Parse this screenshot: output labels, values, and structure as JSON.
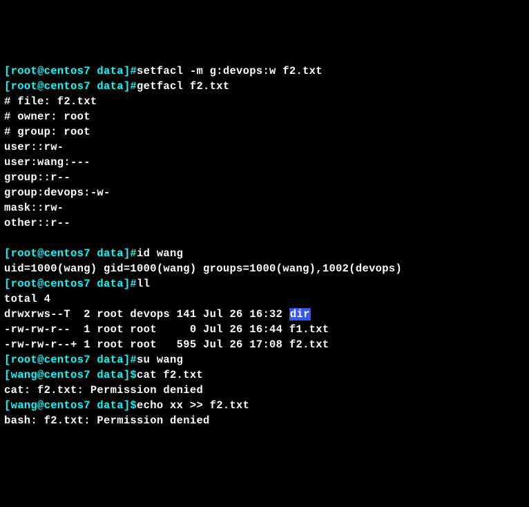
{
  "lines": [
    {
      "segments": [
        {
          "text": "[root@centos7 data]#",
          "class": "cyan"
        },
        {
          "text": "setfacl -m g:devops:w f2.txt",
          "class": "white"
        }
      ]
    },
    {
      "segments": [
        {
          "text": "[root@centos7 data]#",
          "class": "cyan"
        },
        {
          "text": "getfacl f2.txt",
          "class": "white"
        }
      ]
    },
    {
      "segments": [
        {
          "text": "# file: f2.txt",
          "class": "white"
        }
      ]
    },
    {
      "segments": [
        {
          "text": "# owner: root",
          "class": "white"
        }
      ]
    },
    {
      "segments": [
        {
          "text": "# group: root",
          "class": "white"
        }
      ]
    },
    {
      "segments": [
        {
          "text": "user::rw-",
          "class": "white"
        }
      ]
    },
    {
      "segments": [
        {
          "text": "user:wang:---",
          "class": "white"
        }
      ]
    },
    {
      "segments": [
        {
          "text": "group::r--",
          "class": "white"
        }
      ]
    },
    {
      "segments": [
        {
          "text": "group:devops:-w-",
          "class": "white"
        }
      ]
    },
    {
      "segments": [
        {
          "text": "mask::rw-",
          "class": "white"
        }
      ]
    },
    {
      "segments": [
        {
          "text": "other::r--",
          "class": "white"
        }
      ]
    },
    {
      "segments": [
        {
          "text": " ",
          "class": "white"
        }
      ]
    },
    {
      "segments": [
        {
          "text": "[root@centos7 data]#",
          "class": "cyan"
        },
        {
          "text": "id wang",
          "class": "white"
        }
      ]
    },
    {
      "segments": [
        {
          "text": "uid=1000(wang) gid=1000(wang) groups=1000(wang),1002(devops)",
          "class": "white"
        }
      ]
    },
    {
      "segments": [
        {
          "text": "[root@centos7 data]#",
          "class": "cyan"
        },
        {
          "text": "ll",
          "class": "white"
        }
      ]
    },
    {
      "segments": [
        {
          "text": "total 4",
          "class": "white"
        }
      ]
    },
    {
      "segments": [
        {
          "text": "drwxrws--T  2 root devops 141 Jul 26 16:32 ",
          "class": "white"
        },
        {
          "text": "dir",
          "class": "dir-hl"
        }
      ]
    },
    {
      "segments": [
        {
          "text": "-rw-rw-r--  1 root root     0 Jul 26 16:44 f1.txt",
          "class": "white"
        }
      ]
    },
    {
      "segments": [
        {
          "text": "-rw-rw-r--+ 1 root root   595 Jul 26 17:08 f2.txt",
          "class": "white"
        }
      ]
    },
    {
      "segments": [
        {
          "text": "[root@centos7 data]#",
          "class": "cyan"
        },
        {
          "text": "su wang",
          "class": "white"
        }
      ]
    },
    {
      "segments": [
        {
          "text": "[wang@centos7 data]$",
          "class": "cyan"
        },
        {
          "text": "cat f2.txt",
          "class": "white"
        }
      ]
    },
    {
      "segments": [
        {
          "text": "cat: f2.txt: Permission denied",
          "class": "white"
        }
      ]
    },
    {
      "segments": [
        {
          "text": "[wang@centos7 data]$",
          "class": "cyan"
        },
        {
          "text": "echo xx >> f2.txt",
          "class": "white"
        }
      ]
    },
    {
      "segments": [
        {
          "text": "bash: f2.txt: Permission denied",
          "class": "white"
        }
      ]
    }
  ]
}
